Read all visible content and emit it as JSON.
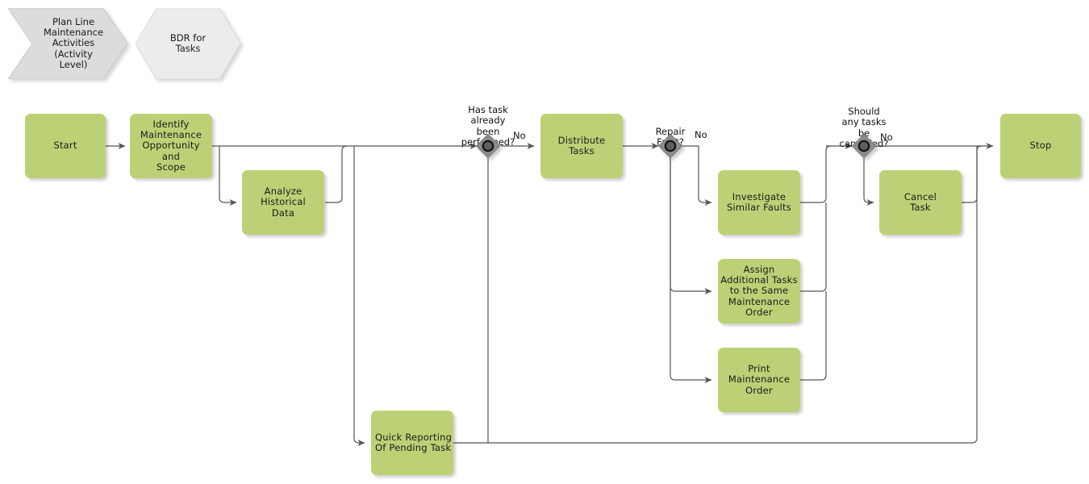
{
  "diagram": {
    "title": "Plan Line Maintenance Activities (Activity Level) - BDR for Tasks",
    "colors": {
      "task_fill": "#bcd176",
      "gateway_fill": "#8c8c8c",
      "crumb_fill_active": "#dcdcdc",
      "crumb_fill_inactive": "#ececec",
      "edge_stroke": "#555555",
      "text": "#1a1a1a"
    }
  },
  "breadcrumbs": [
    {
      "id": "crumb-plan-line",
      "label": "Plan Line\nMaintenance\nActivities\n(Activity\nLevel)",
      "shape": "chevron",
      "state": "active"
    },
    {
      "id": "crumb-bdr-tasks",
      "label": "BDR for\nTasks",
      "shape": "hexagon",
      "state": "inactive"
    }
  ],
  "tasks": [
    {
      "id": "task-start",
      "label": "Start"
    },
    {
      "id": "task-identify",
      "label": "Identify\nMaintenance\nOpportunity and\nScope"
    },
    {
      "id": "task-analyze",
      "label": "Analyze\nHistorical\nData"
    },
    {
      "id": "task-distribute",
      "label": "Distribute\nTasks"
    },
    {
      "id": "task-investigate",
      "label": "Investigate\nSimilar Faults"
    },
    {
      "id": "task-assign",
      "label": "Assign\nAdditional Tasks\nto the Same\nMaintenance\nOrder"
    },
    {
      "id": "task-print",
      "label": "Print\nMaintenance\nOrder"
    },
    {
      "id": "task-cancel",
      "label": "Cancel\nTask"
    },
    {
      "id": "task-quick-report",
      "label": "Quick Reporting\nOf Pending Task"
    },
    {
      "id": "task-stop",
      "label": "Stop"
    }
  ],
  "gateways": [
    {
      "id": "gateway-has-task-performed",
      "label": "Has task\nalready\nbeen\nperformed?",
      "type": "complex-gateway"
    },
    {
      "id": "gateway-repair-fault",
      "label": "Repair\nFault?",
      "type": "complex-gateway"
    },
    {
      "id": "gateway-cancel-tasks",
      "label": "Should\nany tasks\nbe\ncancelled?",
      "type": "complex-gateway"
    }
  ],
  "edge_labels": [
    {
      "id": "edge-label-no-1",
      "label": "No"
    },
    {
      "id": "edge-label-no-2",
      "label": "No"
    },
    {
      "id": "edge-label-no-3",
      "label": "No"
    }
  ]
}
